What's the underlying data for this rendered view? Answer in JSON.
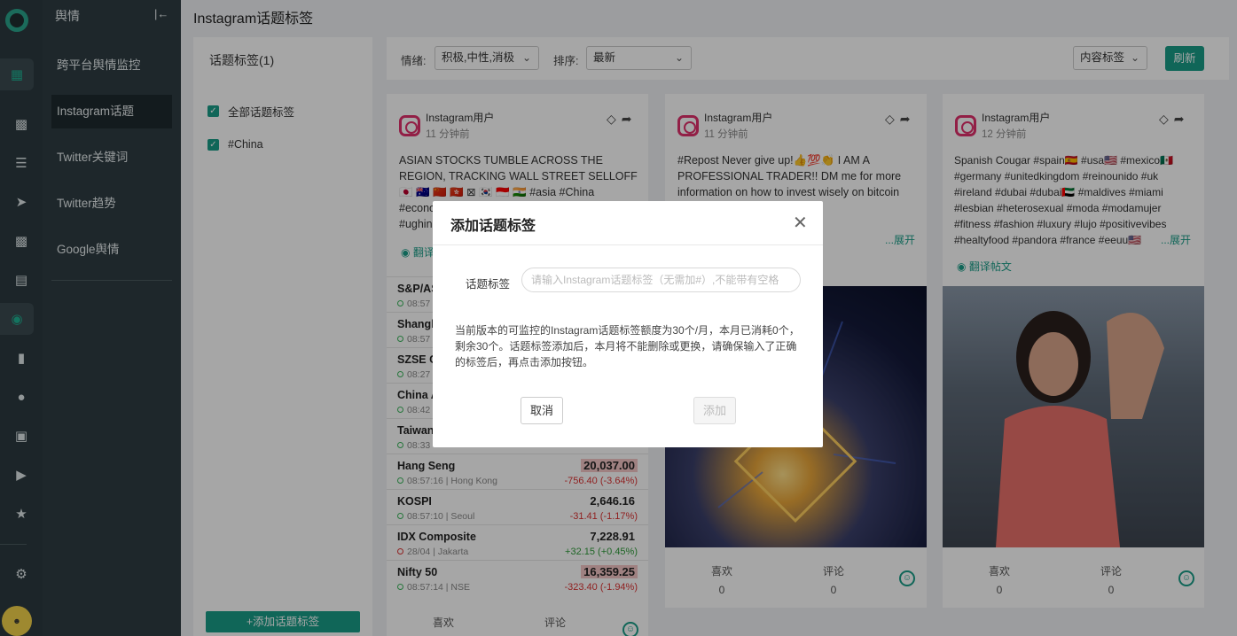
{
  "nav": {
    "title": "舆情",
    "items": [
      {
        "label": "跨平台舆情监控"
      },
      {
        "label": "Instagram话题"
      },
      {
        "label": "Twitter关键词"
      },
      {
        "label": "Twitter趋势"
      },
      {
        "label": "Google舆情"
      }
    ]
  },
  "page": {
    "title": "Instagram话题标签"
  },
  "tag_panel": {
    "header": "话题标签(1)",
    "options": [
      {
        "label": "全部话题标签"
      },
      {
        "label": "#China"
      }
    ],
    "add_label": "+添加话题标签"
  },
  "filters": {
    "sentiment_label": "情绪:",
    "sentiment_value": "积极,中性,消极",
    "sort_label": "排序:",
    "sort_value": "最新",
    "content_tag_label": "内容标签",
    "refresh_label": "刷新"
  },
  "cards": [
    {
      "user": "Instagram用户",
      "time": "11 分钟前",
      "text_lines": [
        "ASIAN STOCKS TUMBLE ACROSS THE",
        "REGION, TRACKING WALL STREET SELLOFF",
        "🇯🇵 🇦🇺 🇨🇳 🇭🇰 ⊠ 🇰🇷 🇮🇩 🇮🇳 #asia #China",
        "#econo",
        "#ughin"
      ],
      "translate": "翻译",
      "market_rows": [
        {
          "name": "S&P/AS",
          "time": "08:57",
          "value": "",
          "change": ""
        },
        {
          "name": "Shangh",
          "time": "08:57",
          "value": "",
          "change": ""
        },
        {
          "name": "SZSE C",
          "time": "08:27",
          "value": "",
          "change": ""
        },
        {
          "name": "China A",
          "time": "08:42",
          "value": "",
          "change": ""
        },
        {
          "name": "Taiwan",
          "time": "08:33",
          "value": "",
          "change": ""
        },
        {
          "name": "Hang Seng",
          "time": "08:57:16 | Hong Kong",
          "value": "20,037.00",
          "change": "-756.40 (-3.64%)"
        },
        {
          "name": "KOSPI",
          "time": "08:57:10 | Seoul",
          "value": "2,646.16",
          "change": "-31.41 (-1.17%)"
        },
        {
          "name": "IDX Composite",
          "time": "28/04 | Jakarta",
          "value": "7,228.91",
          "change": "+32.15 (+0.45%)"
        },
        {
          "name": "Nifty 50",
          "time": "08:57:14 | NSE",
          "value": "16,359.25",
          "change": "-323.40 (-1.94%)"
        }
      ],
      "likes_label": "喜欢",
      "comments_label": "评论",
      "likes": "0",
      "comments": "0"
    },
    {
      "user": "Instagram用户",
      "time": "11 分钟前",
      "text_lines": [
        "#Repost Never give up!👍💯👏 I AM A",
        "PROFESSIONAL TRADER!! DM me for more",
        "information on how to invest wisely on bitcoin",
        "a #china",
        "ndon #canada",
        "fornia..."
      ],
      "more": "...展开",
      "likes_label": "喜欢",
      "comments_label": "评论",
      "likes": "0",
      "comments": "0"
    },
    {
      "user": "Instagram用户",
      "time": "12 分钟前",
      "text_lines": [
        "Spanish Cougar #spain🇪🇸 #usa🇺🇸 #mexico🇲🇽",
        "#germany #unitedkingdom #reinounido #uk",
        "#ireland #dubai #dubai🇦🇪 #maldives #miami",
        "#lesbian #heterosexual #moda #modamujer",
        "#fitness #fashion #luxury #lujo #positivevibes",
        "#healtyfood #pandora #france #eeuu🇺🇸"
      ],
      "more": "...展开",
      "translate": "翻译帖文",
      "likes_label": "喜欢",
      "comments_label": "评论",
      "likes": "0",
      "comments": "0"
    }
  ],
  "modal": {
    "title": "添加话题标签",
    "field_label": "话题标签",
    "placeholder": "请输入Instagram话题标签（无需加#）,不能带有空格",
    "note": "当前版本的可监控的Instagram话题标签额度为30个/月，本月已消耗0个，剩余30个。话题标签添加后，本月将不能删除或更换，请确保输入了正确的标签后，再点击添加按钮。",
    "cancel_label": "取消",
    "add_label": "添加"
  },
  "colors": {
    "accent": "#1a9d88",
    "rail": "#2b3a3f",
    "nav": "#2f3d42",
    "negative": "#dd3333",
    "positive": "#2f9d3a"
  },
  "icons": [
    "logo-icon",
    "cluster-icon",
    "dashboard-icon",
    "list-icon",
    "send-icon",
    "chat-icon",
    "document-icon",
    "globe-icon",
    "audio-icon",
    "users-icon",
    "image-icon",
    "video-icon",
    "star-icon",
    "gear-icon",
    "collapse-icon",
    "tag-icon",
    "share-icon",
    "translate-icon",
    "smile-icon",
    "close-icon",
    "chevron-down-icon",
    "instagram-icon"
  ]
}
